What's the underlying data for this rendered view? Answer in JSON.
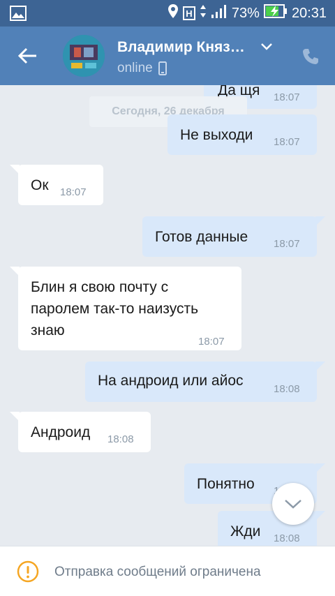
{
  "status_bar": {
    "network_badge": "H",
    "battery": "73%",
    "time": "20:31"
  },
  "header": {
    "contact_name": "Владимир Княз…",
    "status": "online"
  },
  "chat": {
    "date_separator": "Сегодня, 26 декабря",
    "messages": [
      {
        "direction": "out",
        "text": "Да щя",
        "time": "18:07"
      },
      {
        "direction": "out",
        "text": "Не выходи",
        "time": "18:07"
      },
      {
        "direction": "in",
        "text": "Ок",
        "time": "18:07"
      },
      {
        "direction": "out",
        "text": "Готов данные",
        "time": "18:07"
      },
      {
        "direction": "in",
        "lines": [
          "Блин я свою почту с",
          "паролем так-то наизусть",
          "знаю"
        ],
        "time": "18:07"
      },
      {
        "direction": "out",
        "text": "На андроид или айос",
        "time": "18:08"
      },
      {
        "direction": "in",
        "text": "Андроид",
        "time": "18:08"
      },
      {
        "direction": "out",
        "text": "Понятно",
        "time": "18:08"
      },
      {
        "direction": "out",
        "text": "Жди",
        "time": "18:08"
      }
    ]
  },
  "footer": {
    "notice": "Отправка сообщений ограничена"
  },
  "colors": {
    "status_bar": "#3d6494",
    "header": "#5181b8",
    "chat_background": "#e7ebf0",
    "outgoing_bubble": "#d9e8fa",
    "incoming_bubble": "#ffffff",
    "warning": "#f5a623"
  },
  "icons": [
    "image-icon",
    "location-icon",
    "signal-icon",
    "battery-charging-icon",
    "back-arrow-icon",
    "chevron-down-icon",
    "phone-icon",
    "mobile-device-icon",
    "scroll-down-chevron-icon",
    "warning-icon"
  ]
}
